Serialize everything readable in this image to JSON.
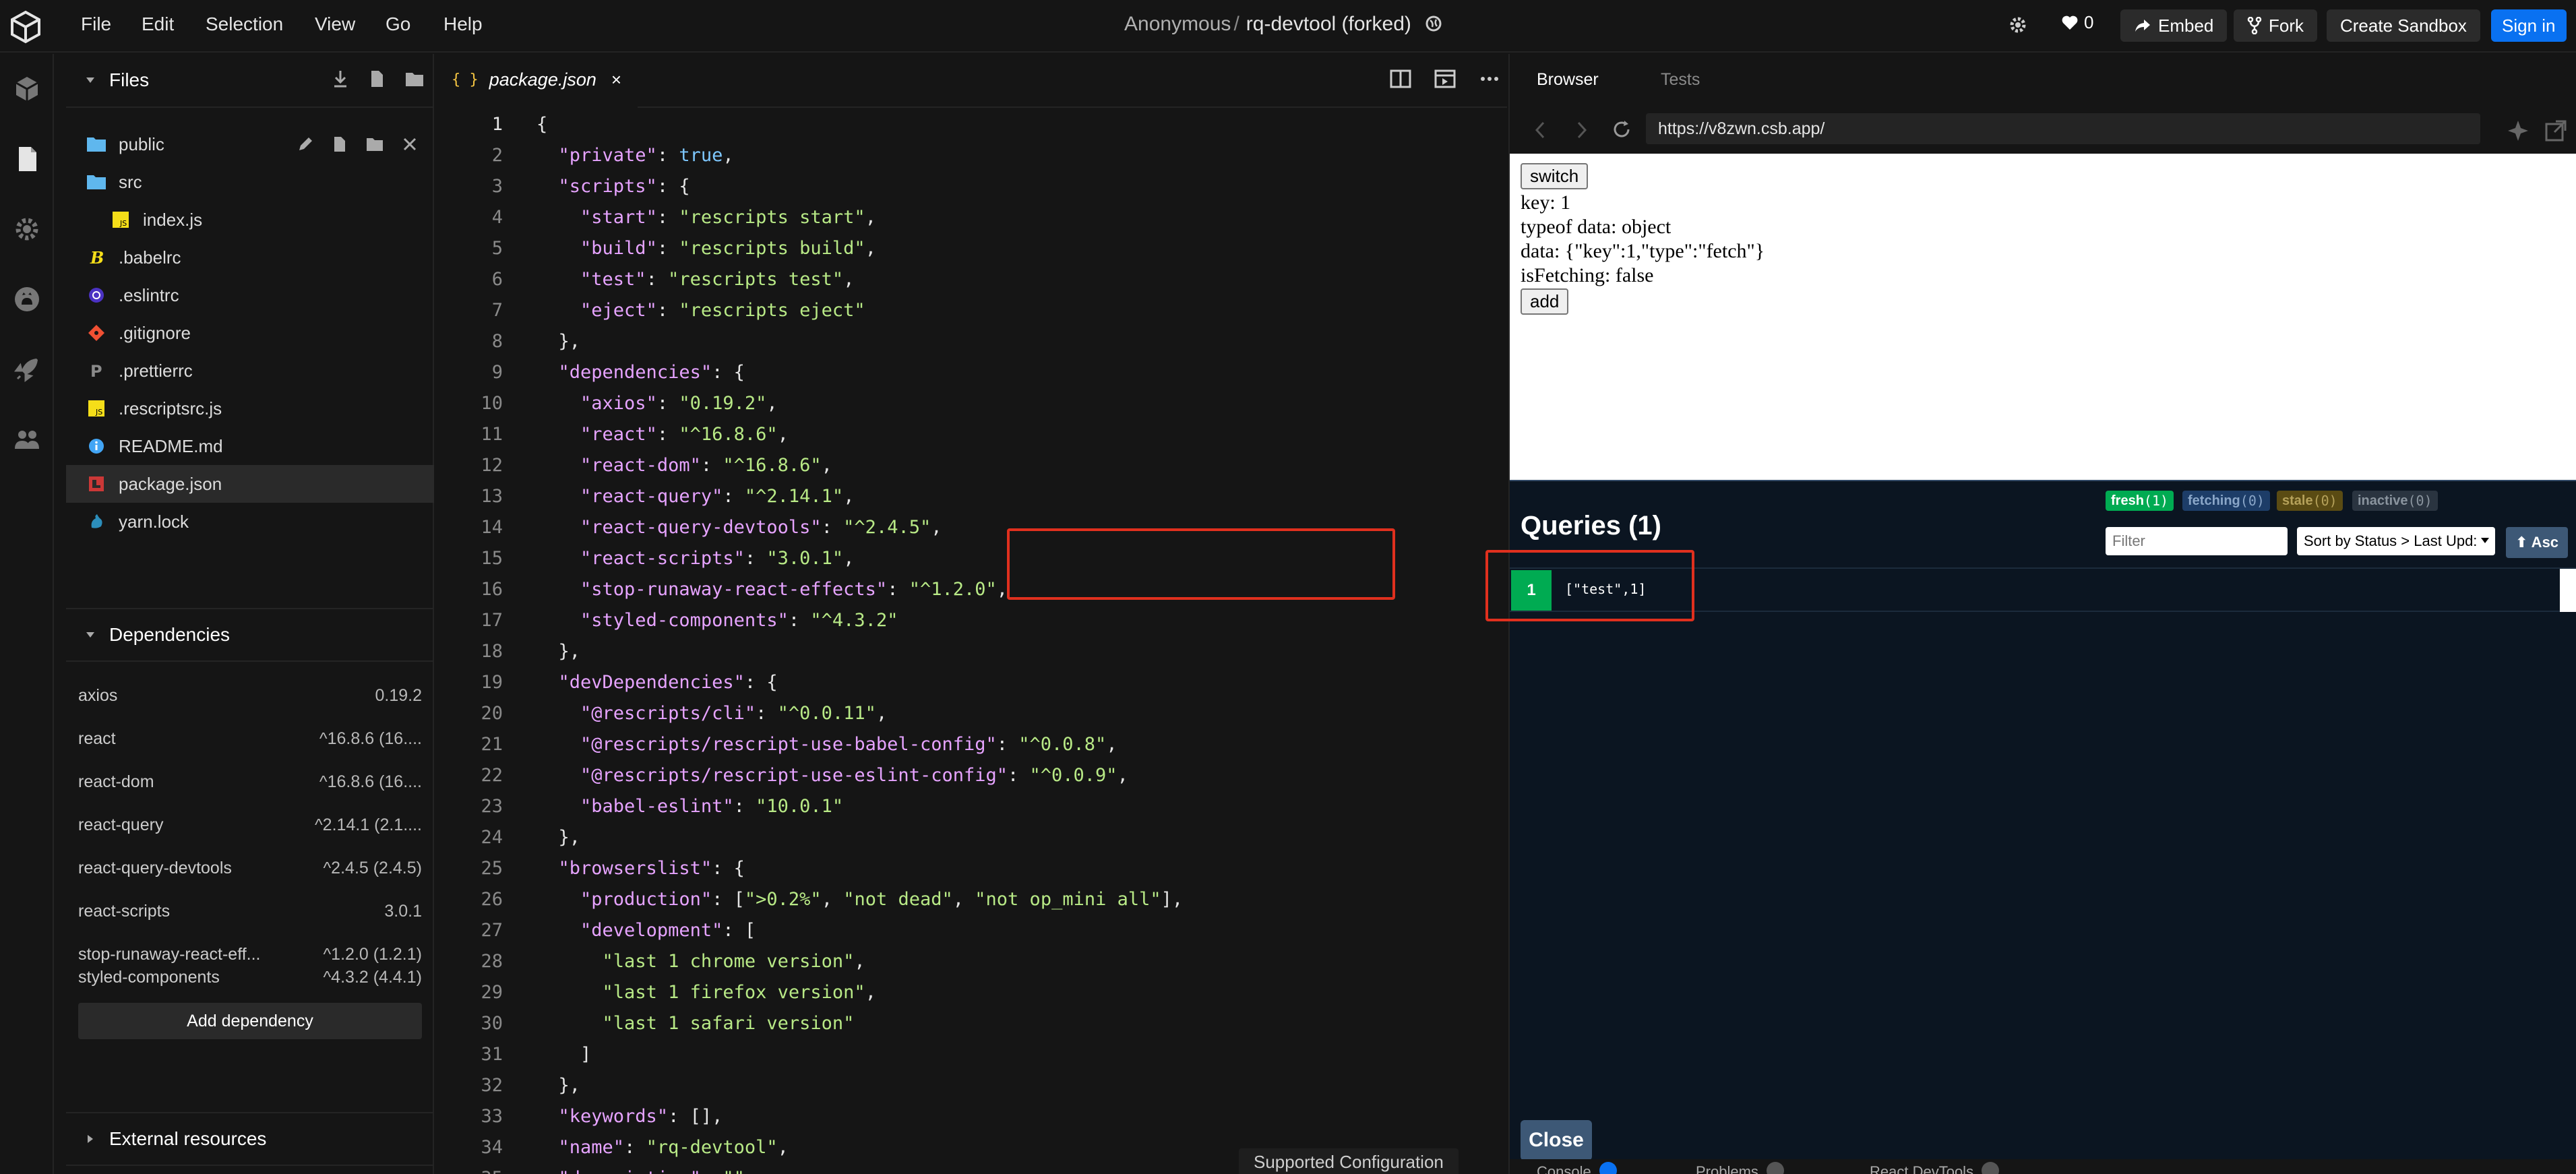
{
  "menubar": {
    "items": [
      "File",
      "Edit",
      "Selection",
      "View",
      "Go",
      "Help"
    ],
    "title_owner": "Anonymous",
    "title_sep": "/",
    "title_name": "rq-devtool (forked)",
    "likes": "0",
    "embed_label": "Embed",
    "fork_label": "Fork",
    "create_label": "Create Sandbox",
    "signin_label": "Sign in"
  },
  "explorer": {
    "title": "Files",
    "files": [
      {
        "name": "public",
        "icon": "folder-icon"
      },
      {
        "name": "src",
        "icon": "folder-icon"
      },
      {
        "name": "index.js",
        "icon": "js-file-icon"
      },
      {
        "name": ".babelrc",
        "icon": "babel-icon"
      },
      {
        "name": ".eslintrc",
        "icon": "eslint-icon"
      },
      {
        "name": ".gitignore",
        "icon": "git-icon"
      },
      {
        "name": ".prettierrc",
        "icon": "prettier-icon"
      },
      {
        "name": ".rescriptsrc.js",
        "icon": "js-file-icon"
      },
      {
        "name": "README.md",
        "icon": "info-icon"
      },
      {
        "name": "package.json",
        "icon": "npm-icon"
      },
      {
        "name": "yarn.lock",
        "icon": "yarn-icon"
      }
    ],
    "dependencies_title": "Dependencies",
    "dependencies": [
      {
        "name": "axios",
        "version": "0.19.2"
      },
      {
        "name": "react",
        "version": "^16.8.6 (16...."
      },
      {
        "name": "react-dom",
        "version": "^16.8.6 (16...."
      },
      {
        "name": "react-query",
        "version": "^2.14.1 (2.1...."
      },
      {
        "name": "react-query-devtools",
        "version": "^2.4.5 (2.4.5)"
      },
      {
        "name": "react-scripts",
        "version": "3.0.1"
      },
      {
        "name": "stop-runaway-react-eff...",
        "version": "^1.2.0 (1.2.1)"
      },
      {
        "name": "styled-components",
        "version": "^4.3.2 (4.4.1)"
      }
    ],
    "add_dependency_label": "Add dependency",
    "external_title": "External resources"
  },
  "editor": {
    "tab_icon": "{ }",
    "tab_label": "package.json",
    "tab_close": "×",
    "lines": [
      "{",
      "  \"private\": true,",
      "  \"scripts\": {",
      "    \"start\": \"rescripts start\",",
      "    \"build\": \"rescripts build\",",
      "    \"test\": \"rescripts test\",",
      "    \"eject\": \"rescripts eject\"",
      "  },",
      "  \"dependencies\": {",
      "    \"axios\": \"0.19.2\",",
      "    \"react\": \"^16.8.6\",",
      "    \"react-dom\": \"^16.8.6\",",
      "    \"react-query\": \"^2.14.1\",",
      "    \"react-query-devtools\": \"^2.4.5\",",
      "    \"react-scripts\": \"3.0.1\",",
      "    \"stop-runaway-react-effects\": \"^1.2.0\",",
      "    \"styled-components\": \"^4.3.2\"",
      "  },",
      "  \"devDependencies\": {",
      "    \"@rescripts/cli\": \"^0.0.11\",",
      "    \"@rescripts/rescript-use-babel-config\": \"^0.0.8\",",
      "    \"@rescripts/rescript-use-eslint-config\": \"^0.0.9\",",
      "    \"babel-eslint\": \"10.0.1\"",
      "  },",
      "  \"browserslist\": {",
      "    \"production\": [\">0.2%\", \"not dead\", \"not op_mini all\"],",
      "    \"development\": [",
      "      \"last 1 chrome version\",",
      "      \"last 1 firefox version\",",
      "      \"last 1 safari version\"",
      "    ]",
      "  },",
      "  \"keywords\": [],",
      "  \"name\": \"rq-devtool\",",
      "  \"description\": \"\","
    ],
    "supported_config_label": "Supported Configuration"
  },
  "preview": {
    "tab_browser": "Browser",
    "tab_tests": "Tests",
    "url": "https://v8zwn.csb.app/",
    "app": {
      "switch_label": "switch",
      "key_text": "key: 1",
      "typeof_text": "typeof data: object",
      "data_text": "data: {\"key\":1,\"type\":\"fetch\"}",
      "fetching_text": "isFetching: false",
      "add_label": "add"
    },
    "devtools": {
      "title": "Queries (1)",
      "badges": [
        {
          "label": "fresh",
          "count": "(1)",
          "bg": "#00ab52",
          "fg": "#ffffff"
        },
        {
          "label": "fetching",
          "count": "(0)",
          "bg": "#1d3d68",
          "fg": "#8aa6c8"
        },
        {
          "label": "stale",
          "count": "(0)",
          "bg": "#5a4b13",
          "fg": "#b5a15a"
        },
        {
          "label": "inactive",
          "count": "(0)",
          "bg": "#2a3440",
          "fg": "#8a949e"
        }
      ],
      "filter_placeholder": "Filter",
      "sort_label": "Sort by Status > Last Upd:",
      "asc_label": "⬆ Asc",
      "query_count": "1",
      "query_key": "[\"test\",1]",
      "close_label": "Close"
    },
    "bottom_tabs": [
      {
        "label": "Console",
        "badge_color": "#0971f1"
      },
      {
        "label": "Problems",
        "badge_color": "#555555"
      },
      {
        "label": "React DevTools",
        "badge_color": "#555555"
      }
    ]
  },
  "colors": {
    "accent": "#0971f1",
    "highlight": "#e0301e",
    "fresh": "#00ab52"
  }
}
